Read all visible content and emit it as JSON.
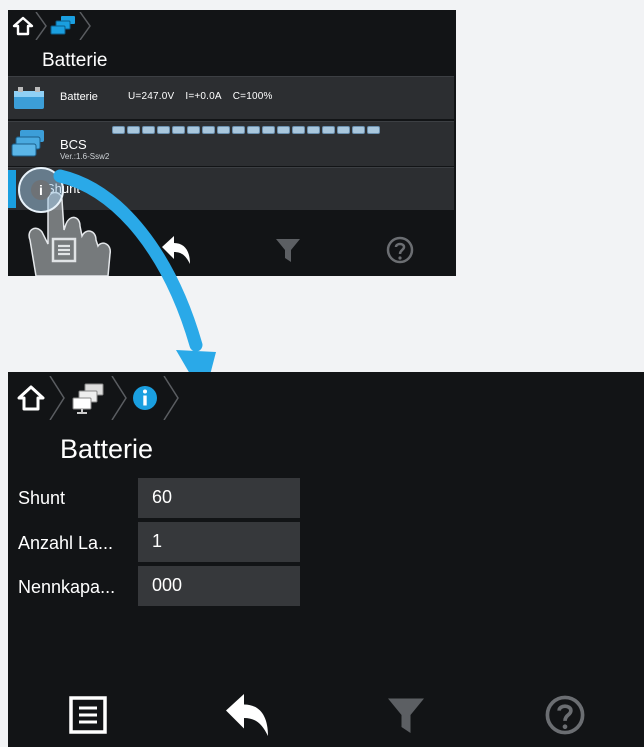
{
  "top": {
    "title": "Batterie",
    "rows": [
      {
        "label": "Batterie",
        "u": "U=247.0V",
        "i": "I=+0.0A",
        "c": "C=100%"
      },
      {
        "label": "BCS",
        "sub": "Ver.:1.6-Ssw2"
      },
      {
        "label": "Shunt"
      }
    ]
  },
  "bottom": {
    "title": "Batterie",
    "fields": [
      {
        "label": "Shunt",
        "value": "60"
      },
      {
        "label": "Anzahl La...",
        "value": "1"
      },
      {
        "label": "Nennkapa...",
        "value": "000"
      }
    ]
  },
  "icons": {
    "home": "home-icon",
    "devices": "devices-icon",
    "info": "info-icon",
    "menu": "menu-icon",
    "back": "back-arrow-icon",
    "filter": "filter-icon",
    "help": "help-icon"
  },
  "colors": {
    "panel": "#121416",
    "row": "#2c2e31",
    "field": "#36383b",
    "accent": "#1a9fe0",
    "disabled": "#5c5f63"
  }
}
